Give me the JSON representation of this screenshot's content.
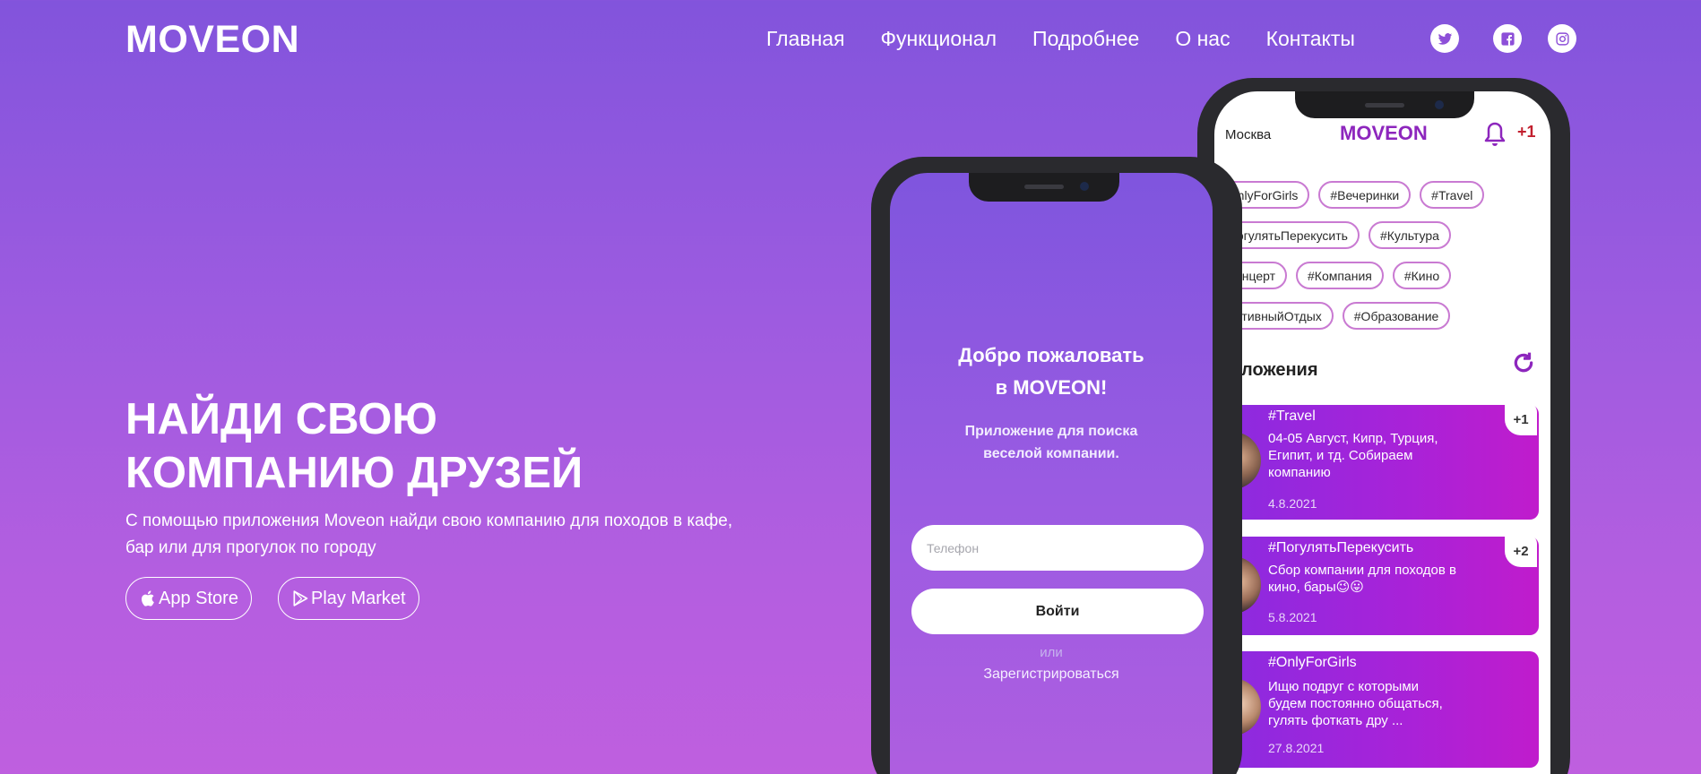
{
  "nav": {
    "logo": "MOVEON",
    "menu": [
      "Главная",
      "Функционал",
      "Подробнее",
      "О нас",
      "Контакты"
    ],
    "social": [
      "twitter-icon",
      "facebook-icon",
      "instagram-icon"
    ]
  },
  "hero": {
    "title_line1": "НАЙДИ СВОЮ",
    "title_line2": "КОМПАНИЮ ДРУЗЕЙ",
    "subtitle": "С помощью приложения Moveon найди свою компанию для походов в кафе, бар или для прогулок по городу",
    "app_store": "App Store",
    "play_market": "Play Market"
  },
  "login_screen": {
    "welcome_line1": "Добро пожаловать",
    "welcome_line2": "в MOVEON!",
    "tagline_line1": "Приложение для поиска",
    "tagline_line2": "веселой компании.",
    "phone_placeholder": "Телефон",
    "login_button": "Войти",
    "or": "или",
    "register": "Зарегистрироваться"
  },
  "feed_screen": {
    "city": "Москва",
    "logo": "MOVEON",
    "notifications": "+1",
    "tag_rows": [
      [
        "#OnlyForGirls",
        "#Вечеринки",
        "#Travel"
      ],
      [
        "#ПогулятьПерекусить",
        "#Культура"
      ],
      [
        "#Концерт",
        "#Компания",
        "#Кино"
      ],
      [
        "#АктивныйОтдых",
        "#Образование"
      ]
    ],
    "offers_heading": "редложения",
    "cards": [
      {
        "tag": "#Travel",
        "text": "04-05 Август, Кипр, Турция, Египит, и тд. Собираем компанию",
        "date": "4.8.2021",
        "badge": "+1"
      },
      {
        "tag": "#ПогулятьПерекусить",
        "text": "Сбор компании для походов в кино, бары😉😛",
        "date": "5.8.2021",
        "badge": "+2"
      },
      {
        "tag": "#OnlyForGirls",
        "text": "Ищю подруг с которыми будем постоянно общаться, гулять фоткать дру ...",
        "date": "27.8.2021",
        "badge": ""
      }
    ]
  },
  "colors": {
    "bg_top": "#8254dc",
    "bg_bottom": "#bf5fdf",
    "brand_purple": "#8d26bd",
    "card_gradient_start": "#8a2be0",
    "card_gradient_end": "#c01ccc",
    "notification_red": "#c21f2e"
  }
}
